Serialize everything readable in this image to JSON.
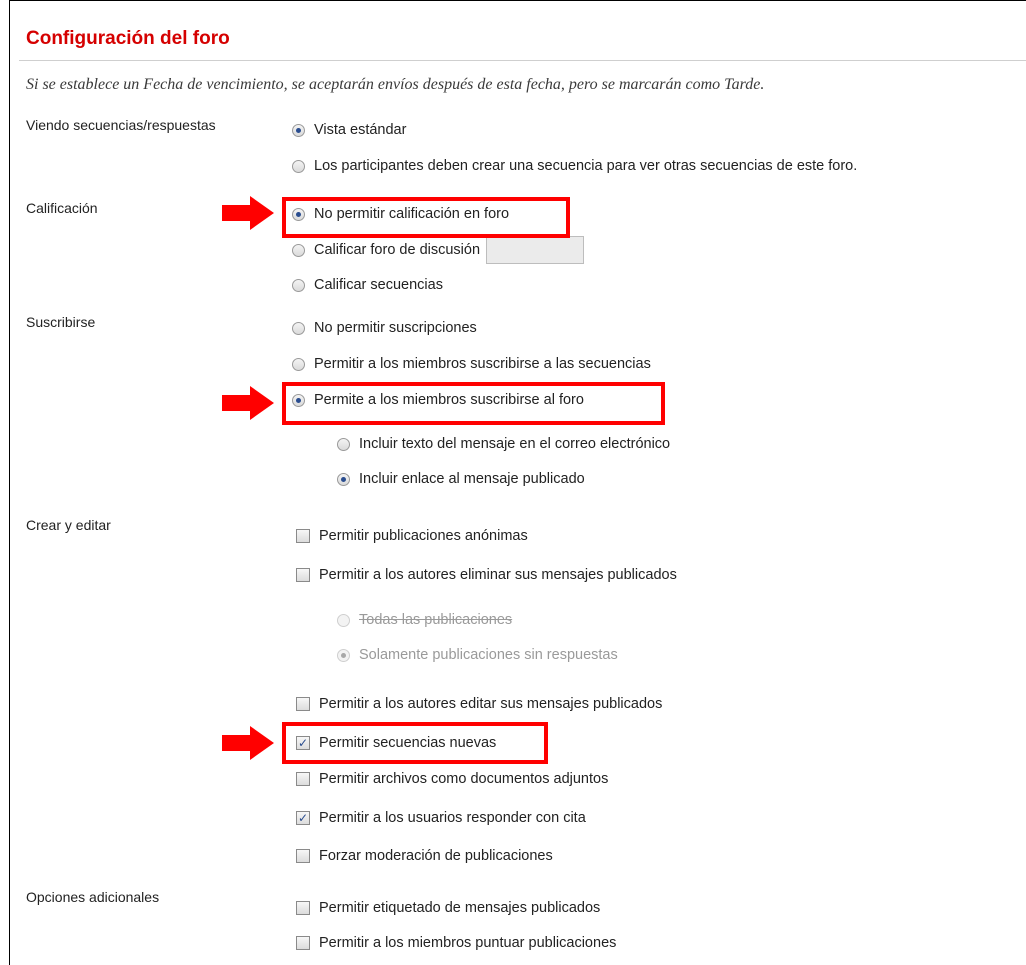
{
  "title": "Configuración del foro",
  "note": "Si se establece un Fecha de vencimiento, se aceptarán envíos después de esta fecha, pero se marcarán como Tarde.",
  "sections": {
    "viewing": "Viendo secuencias/respuestas",
    "grading": "Calificación",
    "subscribe": "Suscribirse",
    "create_edit": "Crear y editar",
    "additional": "Opciones adicionales"
  },
  "viewing": {
    "standard": "Vista estándar",
    "must_create": "Los participantes deben crear una secuencia para ver otras secuencias de este foro."
  },
  "grading": {
    "no_grading": "No permitir calificación en foro",
    "grade_forum": "Calificar foro de discusión",
    "grade_forum_value": "",
    "grade_threads": "Calificar secuencias"
  },
  "subscribe": {
    "none": "No permitir suscripciones",
    "threads": "Permitir a los miembros suscribirse a las secuencias",
    "forum": "Permite a los miembros suscribirse al foro",
    "include_text": "Incluir texto del mensaje en el correo electrónico",
    "include_link": "Incluir enlace al mensaje publicado"
  },
  "create_edit": {
    "anonymous": "Permitir publicaciones anónimas",
    "delete_own": "Permitir a los autores eliminar sus mensajes publicados",
    "all_posts": "Todas las publicaciones",
    "only_unreplied": "Solamente publicaciones sin respuestas",
    "edit_own": "Permitir a los autores editar sus mensajes publicados",
    "new_threads": "Permitir secuencias nuevas",
    "attachments": "Permitir archivos como documentos adjuntos",
    "reply_quote": "Permitir a los usuarios responder con cita",
    "moderation": "Forzar moderación de publicaciones"
  },
  "additional": {
    "tagging": "Permitir etiquetado de mensajes publicados",
    "rating": "Permitir a los miembros puntuar publicaciones"
  },
  "checkmark": "✓",
  "colors": {
    "title": "#d50000",
    "highlight": "#ff0000",
    "selected": "#2a4d8f"
  }
}
